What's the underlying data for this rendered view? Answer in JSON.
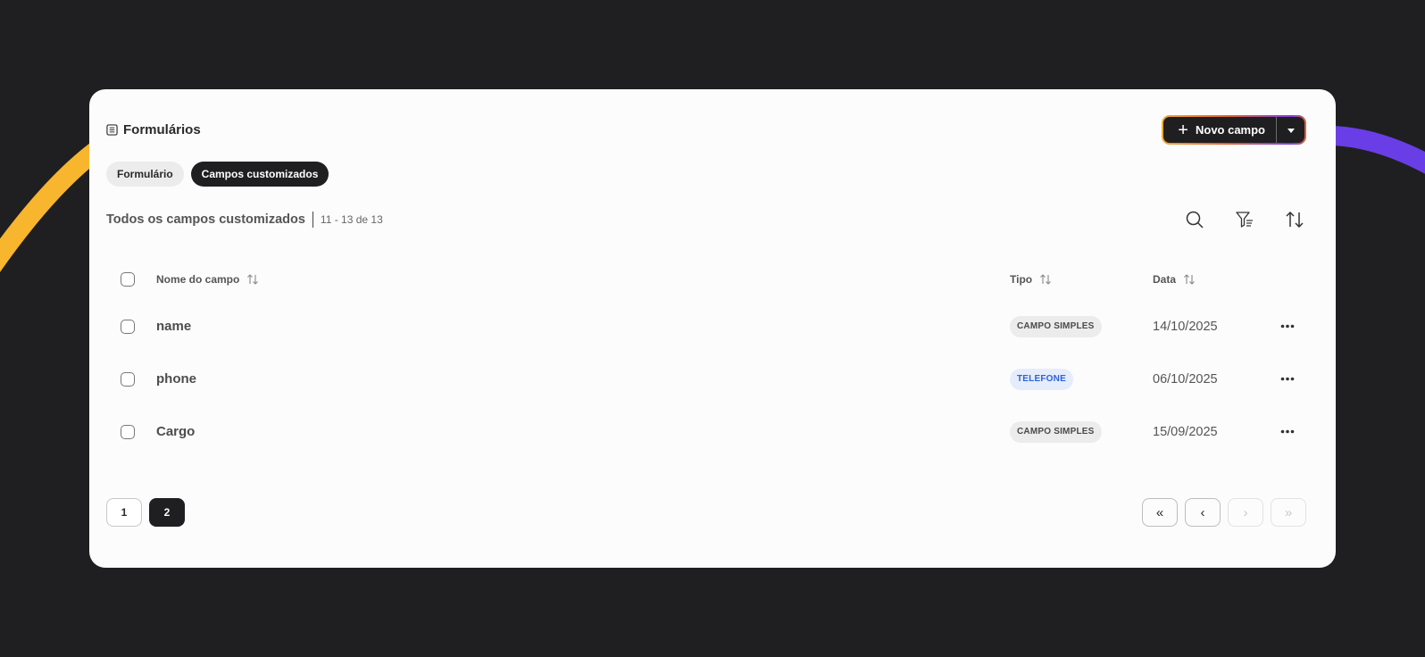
{
  "header": {
    "title": "Formulários",
    "new_button_label": "Novo campo"
  },
  "tabs": [
    {
      "label": "Formulário",
      "active": false
    },
    {
      "label": "Campos customizados",
      "active": true
    }
  ],
  "list": {
    "title": "Todos os campos customizados",
    "range": "11 - 13 de 13"
  },
  "table": {
    "columns": {
      "name": "Nome do campo",
      "type": "Tipo",
      "date": "Data"
    },
    "rows": [
      {
        "name": "name",
        "type": "CAMPO SIMPLES",
        "date": "14/10/2025"
      },
      {
        "name": "phone",
        "type": "TELEFONE",
        "date": "06/10/2025"
      },
      {
        "name": "Cargo",
        "type": "CAMPO SIMPLES",
        "date": "15/09/2025"
      }
    ]
  },
  "pagination": {
    "pages": [
      "1",
      "2"
    ],
    "current": "2",
    "first": "«",
    "prev": "‹",
    "next": "›",
    "last": "»"
  },
  "colors": {
    "accent_dark": "#1f1f21",
    "badge_blue": "#2c63d8",
    "arc_yellow": "#f8b52e",
    "arc_purple": "#6a3ee6"
  },
  "icons": [
    "form-icon",
    "plus-icon",
    "caret-down-icon",
    "search-icon",
    "filter-icon",
    "sort-icon",
    "more-icon"
  ]
}
